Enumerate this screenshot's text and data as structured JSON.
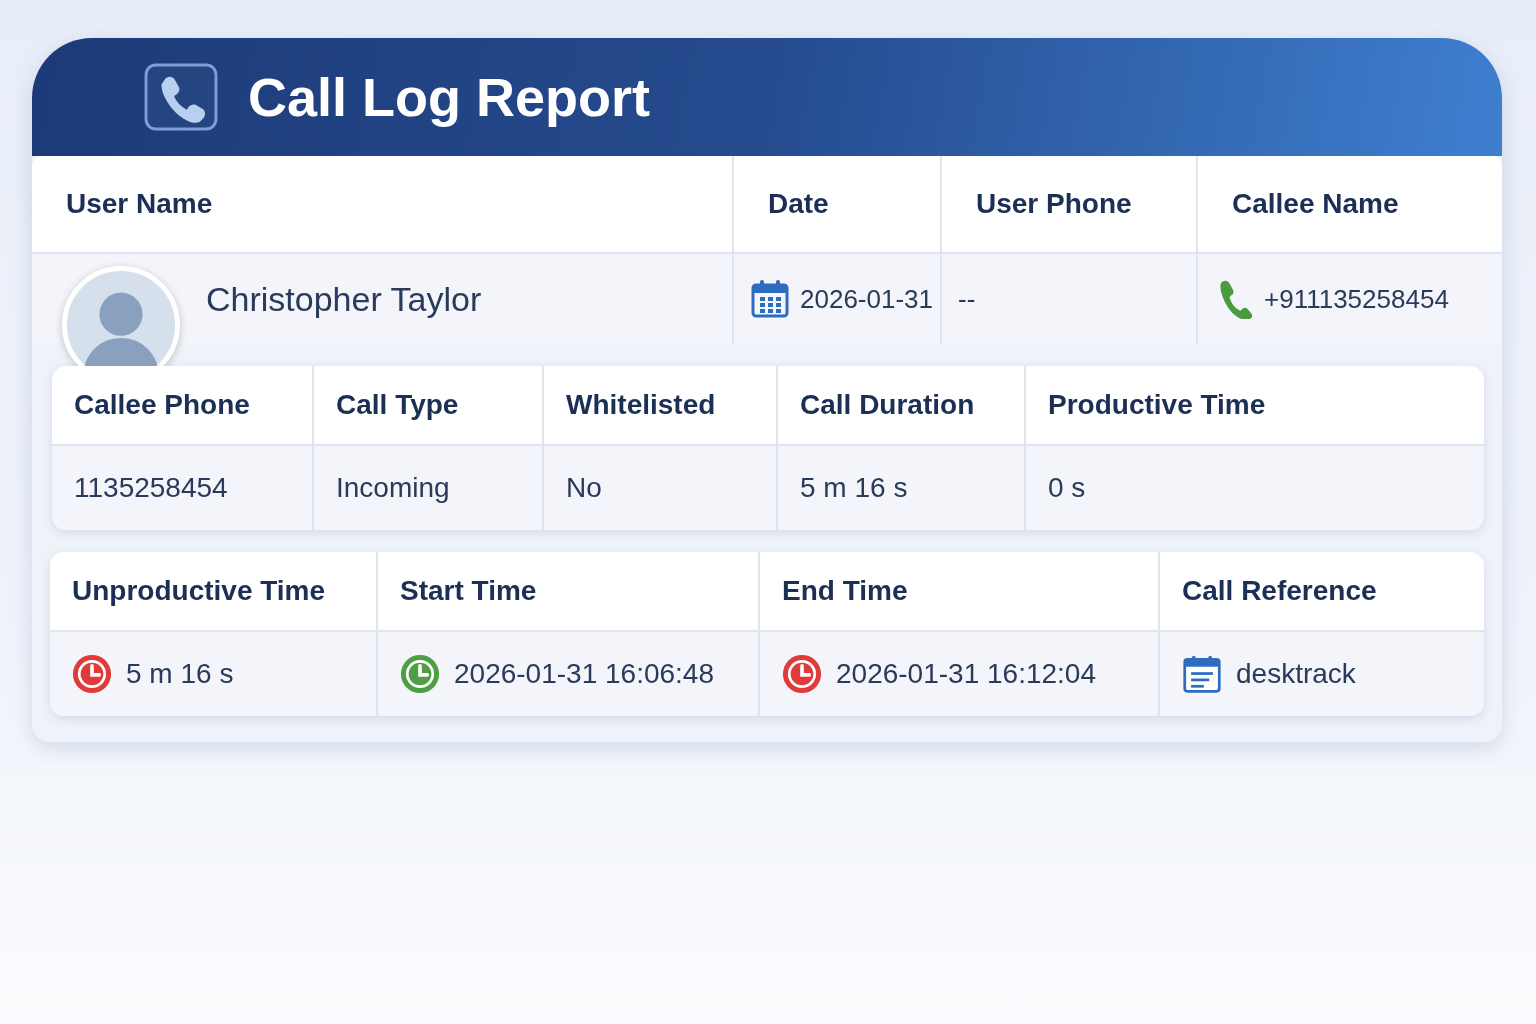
{
  "header": {
    "title": "Call Log Report"
  },
  "tables": [
    {
      "columns": [
        {
          "heading": "User Name",
          "value": "Christopher Taylor",
          "kind": "avatar"
        },
        {
          "heading": "Date",
          "value": "2026-01-31",
          "kind": "calendar"
        },
        {
          "heading": "User Phone",
          "value": "--"
        },
        {
          "heading": "Callee Name",
          "value": "+911135258454",
          "kind": "phone"
        }
      ]
    },
    {
      "columns": [
        {
          "heading": "Callee Phone",
          "value": "1135258454"
        },
        {
          "heading": "Call Type",
          "value": "Incoming"
        },
        {
          "heading": "Whitelisted",
          "value": "No"
        },
        {
          "heading": "Call Duration",
          "value": "5 m 16 s"
        },
        {
          "heading": "Productive Time",
          "value": "0 s"
        }
      ]
    },
    {
      "columns": [
        {
          "heading": "Unproductive Time",
          "value": "5 m 16 s",
          "kind": "clock",
          "color": "#e03a3a"
        },
        {
          "heading": "Start Time",
          "value": "2026-01-31 16:06:48",
          "kind": "clock",
          "color": "#4e9e44"
        },
        {
          "heading": "End Time",
          "value": "2026-01-31 16:12:04",
          "kind": "clock",
          "color": "#e03a3a"
        },
        {
          "heading": "Call Reference",
          "value": "desktrack",
          "kind": "document"
        }
      ]
    }
  ]
}
